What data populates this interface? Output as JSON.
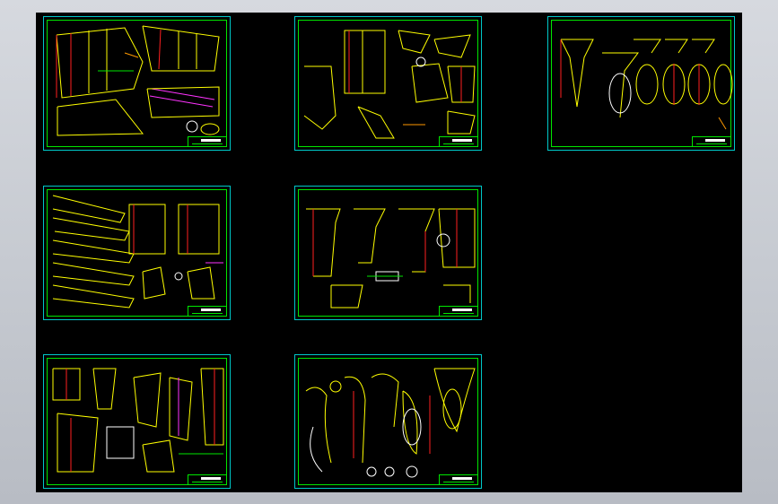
{
  "viewer": {
    "background_color": "#000000",
    "frame_color": "#c8ccd4"
  },
  "sheets": [
    {
      "id": "sheet-1",
      "content": "hull-plan-views-icon"
    },
    {
      "id": "sheet-2",
      "content": "section-details-icon"
    },
    {
      "id": "sheet-3",
      "content": "cross-sections-icon"
    },
    {
      "id": "sheet-4",
      "content": "profile-views-icon"
    },
    {
      "id": "sheet-5",
      "content": "bracket-details-icon"
    },
    {
      "id": "sheet-6",
      "content": "assembly-details-icon"
    },
    {
      "id": "sheet-7",
      "content": "curve-sections-icon"
    }
  ],
  "colors": {
    "border_cyan": "#00c8c8",
    "frame_green": "#00e600",
    "line_yellow": "#ffff00",
    "line_red": "#ff2020",
    "line_white": "#ffffff",
    "line_magenta": "#ff33ff",
    "line_orange": "#ff9900"
  }
}
